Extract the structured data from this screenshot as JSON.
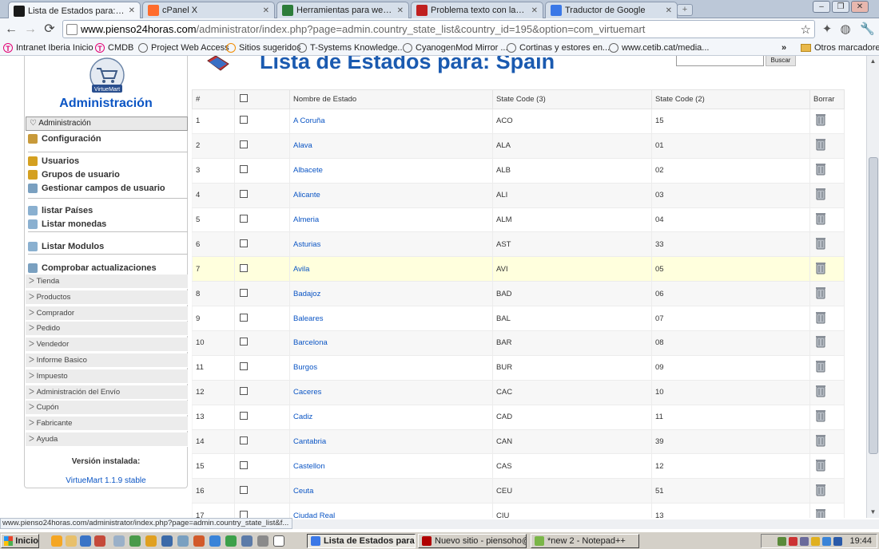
{
  "browser": {
    "tabs": [
      {
        "label": "Lista de Estados para: Spain",
        "favicon": "joomla-icon",
        "fav_color": "#1a1a1a",
        "active": true
      },
      {
        "label": "cPanel X",
        "favicon": "cpanel-icon",
        "fav_color": "#ff6c2c",
        "active": false
      },
      {
        "label": "Herramientas para webmaster",
        "favicon": "google-icon",
        "fav_color": "#2d7d3a",
        "active": false
      },
      {
        "label": "Problema texto con las tildes...",
        "favicon": "site-icon",
        "fav_color": "#c02020",
        "active": false
      },
      {
        "label": "Traductor de Google",
        "favicon": "translate-icon",
        "fav_color": "#3b78e7",
        "active": false
      }
    ],
    "url_host": "www.pienso24horas.com",
    "url_path": "/administrator/index.php?page=admin.country_state_list&country_id=195&option=com_virtuemart",
    "bookmarks": [
      {
        "label": "Intranet Iberia Inicio",
        "icon": "telekom-icon",
        "color": "#e20074"
      },
      {
        "label": "CMDB",
        "icon": "telekom-icon",
        "color": "#e20074"
      },
      {
        "label": "Project Web Access",
        "icon": "globe-icon",
        "color": "#666666"
      },
      {
        "label": "Sitios sugeridos",
        "icon": "bookmark-icon",
        "color": "#f28c00"
      },
      {
        "label": "T-Systems Knowledge...",
        "icon": "globe-icon",
        "color": "#666666"
      },
      {
        "label": "CyanogenMod Mirror ...",
        "icon": "globe-icon",
        "color": "#666666"
      },
      {
        "label": "Cortinas y estores en...",
        "icon": "globe-icon",
        "color": "#666666"
      },
      {
        "label": "www.cetib.cat/media...",
        "icon": "globe-icon",
        "color": "#666666"
      }
    ],
    "more_bookmarks": "»",
    "other_bookmarks": "Otros marcadores"
  },
  "sidebar": {
    "logo_text": "VirtueMart",
    "title": "Administración",
    "toggle_label": "Administración",
    "links": [
      {
        "label": "Configuración",
        "icon": "config-icon"
      },
      {
        "label": "Usuarios",
        "icon": "users-icon"
      },
      {
        "label": "Grupos de usuario",
        "icon": "users-icon"
      },
      {
        "label": "Gestionar campos de usuario",
        "icon": "fields-icon"
      },
      {
        "label": "listar Países",
        "icon": "list-icon"
      },
      {
        "label": "Listar monedas",
        "icon": "list-icon"
      },
      {
        "label": "Listar Modulos",
        "icon": "list-icon"
      },
      {
        "label": "Comprobar actualizaciones",
        "icon": "update-icon"
      }
    ],
    "sections": [
      "Tienda",
      "Productos",
      "Comprador",
      "Pedido",
      "Vendedor",
      "Informe Basico",
      "Impuesto",
      "Administración del Envío",
      "Cupón",
      "Fabricante",
      "Ayuda"
    ],
    "version_label": "Versión instalada:",
    "version_value": "VirtueMart 1.1.9 stable"
  },
  "main": {
    "heading": "Lista de Estados para: Spain",
    "search_button": "Buscar",
    "columns": [
      "#",
      "",
      "Nombre de Estado",
      "State Code (3)",
      "State Code (2)",
      "Borrar"
    ],
    "rows": [
      {
        "n": "1",
        "name": "A Coruña",
        "code3": "ACO",
        "code2": "15"
      },
      {
        "n": "2",
        "name": "Alava",
        "code3": "ALA",
        "code2": "01"
      },
      {
        "n": "3",
        "name": "Albacete",
        "code3": "ALB",
        "code2": "02"
      },
      {
        "n": "4",
        "name": "Alicante",
        "code3": "ALI",
        "code2": "03"
      },
      {
        "n": "5",
        "name": "Almeria",
        "code3": "ALM",
        "code2": "04"
      },
      {
        "n": "6",
        "name": "Asturias",
        "code3": "AST",
        "code2": "33"
      },
      {
        "n": "7",
        "name": "Avila",
        "code3": "AVI",
        "code2": "05"
      },
      {
        "n": "8",
        "name": "Badajoz",
        "code3": "BAD",
        "code2": "06"
      },
      {
        "n": "9",
        "name": "Baleares",
        "code3": "BAL",
        "code2": "07"
      },
      {
        "n": "10",
        "name": "Barcelona",
        "code3": "BAR",
        "code2": "08"
      },
      {
        "n": "11",
        "name": "Burgos",
        "code3": "BUR",
        "code2": "09"
      },
      {
        "n": "12",
        "name": "Caceres",
        "code3": "CAC",
        "code2": "10"
      },
      {
        "n": "13",
        "name": "Cadiz",
        "code3": "CAD",
        "code2": "11"
      },
      {
        "n": "14",
        "name": "Cantabria",
        "code3": "CAN",
        "code2": "39"
      },
      {
        "n": "15",
        "name": "Castellon",
        "code3": "CAS",
        "code2": "12"
      },
      {
        "n": "16",
        "name": "Ceuta",
        "code3": "CEU",
        "code2": "51"
      },
      {
        "n": "17",
        "name": "Ciudad Real",
        "code3": "CIU",
        "code2": "13"
      }
    ],
    "highlighted_row": "7"
  },
  "status_url": "www.pienso24horas.com/administrator/index.php?page=admin.country_state_list&f...",
  "taskbar": {
    "start_label": "Inicio",
    "tasks": [
      {
        "label": "Lista de Estados para:...",
        "icon": "chrome-icon",
        "color": "#3b78e7",
        "active": true
      },
      {
        "label": "Nuevo sitio - piensoho@...",
        "icon": "filezilla-icon",
        "color": "#b00000",
        "active": false
      },
      {
        "label": "*new  2 - Notepad++",
        "icon": "notepad-icon",
        "color": "#7ab648",
        "active": false
      }
    ],
    "clock": "19:44"
  },
  "colors": {
    "link": "#0b55c4",
    "heading": "#1a5ab0",
    "row_highlight": "#ffffdd"
  }
}
